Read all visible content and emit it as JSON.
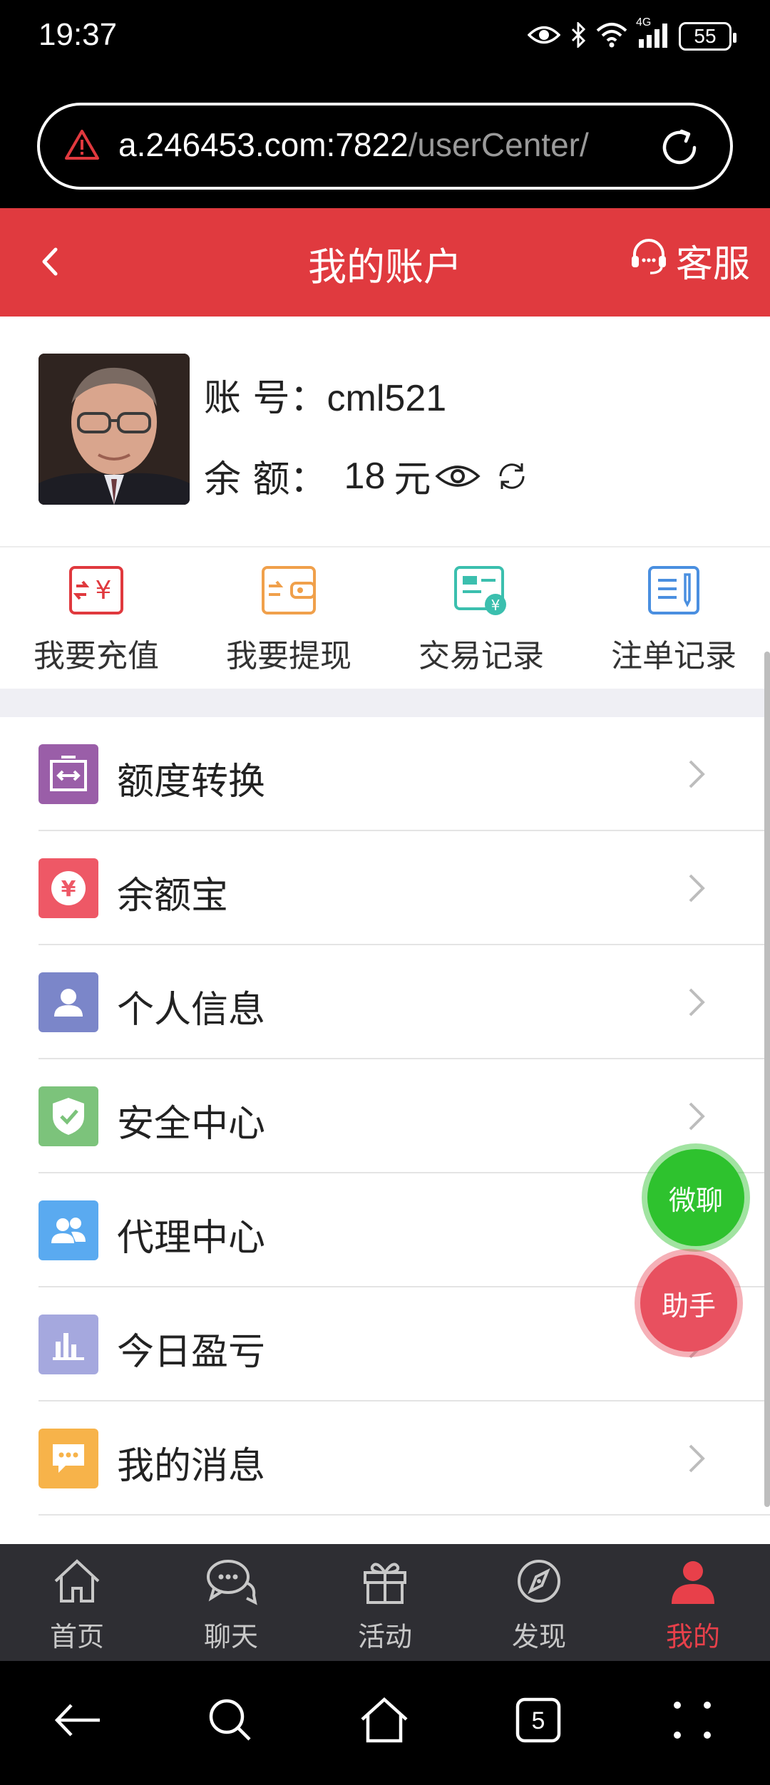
{
  "status_bar": {
    "time": "19:37",
    "network": "4G",
    "battery": "55"
  },
  "browser": {
    "url_host": "a.246453.com:7822",
    "url_path": "/userCenter/"
  },
  "header": {
    "title": "我的账户",
    "customer_service": "客服"
  },
  "profile": {
    "account_label": "账 号：",
    "account_value": "cml521",
    "balance_label": "余 额：",
    "balance_value": "18",
    "balance_unit": "元"
  },
  "quick_actions": [
    {
      "label": "我要充值",
      "icon": "recharge-icon",
      "color": "#e0393e"
    },
    {
      "label": "我要提现",
      "icon": "withdraw-wallet-icon",
      "color": "#f0a04b"
    },
    {
      "label": "交易记录",
      "icon": "transaction-record-icon",
      "color": "#3bbfae"
    },
    {
      "label": "注单记录",
      "icon": "bet-record-icon",
      "color": "#4a8fe0"
    }
  ],
  "menu": [
    {
      "label": "额度转换",
      "icon": "transfer-icon",
      "color": "#9a5ea8"
    },
    {
      "label": "余额宝",
      "icon": "yuan-icon",
      "color": "#ee5866"
    },
    {
      "label": "个人信息",
      "icon": "user-icon",
      "color": "#7b86c9"
    },
    {
      "label": "安全中心",
      "icon": "shield-icon",
      "color": "#7cc37b"
    },
    {
      "label": "代理中心",
      "icon": "agents-icon",
      "color": "#5aaaf0"
    },
    {
      "label": "今日盈亏",
      "icon": "bar-chart-icon",
      "color": "#a5a8de"
    },
    {
      "label": "我的消息",
      "icon": "message-icon",
      "color": "#f7b34a"
    }
  ],
  "float_buttons": {
    "chat": "微聊",
    "assistant": "助手"
  },
  "bottom_nav": [
    {
      "label": "首页",
      "icon": "home-icon"
    },
    {
      "label": "聊天",
      "icon": "chat-icon"
    },
    {
      "label": "活动",
      "icon": "gift-icon"
    },
    {
      "label": "发现",
      "icon": "compass-icon"
    },
    {
      "label": "我的",
      "icon": "profile-icon",
      "active": true
    }
  ],
  "system_nav": {
    "tab_count": "5"
  }
}
